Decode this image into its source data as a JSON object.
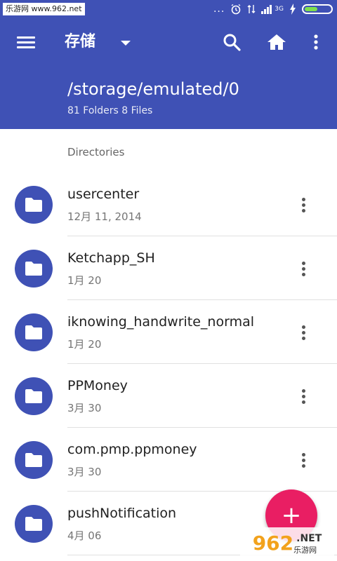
{
  "statusbar": {
    "watermark": "乐游网 www.962.net",
    "icons": [
      "dots-icon",
      "alarm-icon",
      "data-transfer-icon",
      "signal-icon",
      "charging-icon",
      "battery-icon"
    ],
    "dots": "...",
    "network": "3G"
  },
  "appbar": {
    "title": "存储",
    "path": "/storage/emulated/0",
    "counts": "81 Folders 8 Files",
    "actions": [
      "search-icon",
      "home-icon",
      "more-vert-icon"
    ],
    "color": "#3f51b5"
  },
  "section_label": "Directories",
  "folders": [
    {
      "name": "usercenter",
      "date": "12月 11, 2014"
    },
    {
      "name": "Ketchapp_SH",
      "date": "1月 20"
    },
    {
      "name": "iknowing_handwrite_normal",
      "date": "1月 20"
    },
    {
      "name": "PPMoney",
      "date": "3月 30"
    },
    {
      "name": "com.pmp.ppmoney",
      "date": "3月 30"
    },
    {
      "name": "pushNotification",
      "date": "4月 06"
    }
  ],
  "fab": {
    "label": "+",
    "color": "#e91e63"
  },
  "brand": {
    "number": "962",
    "suffix": ".NET",
    "cn": "乐游网"
  }
}
